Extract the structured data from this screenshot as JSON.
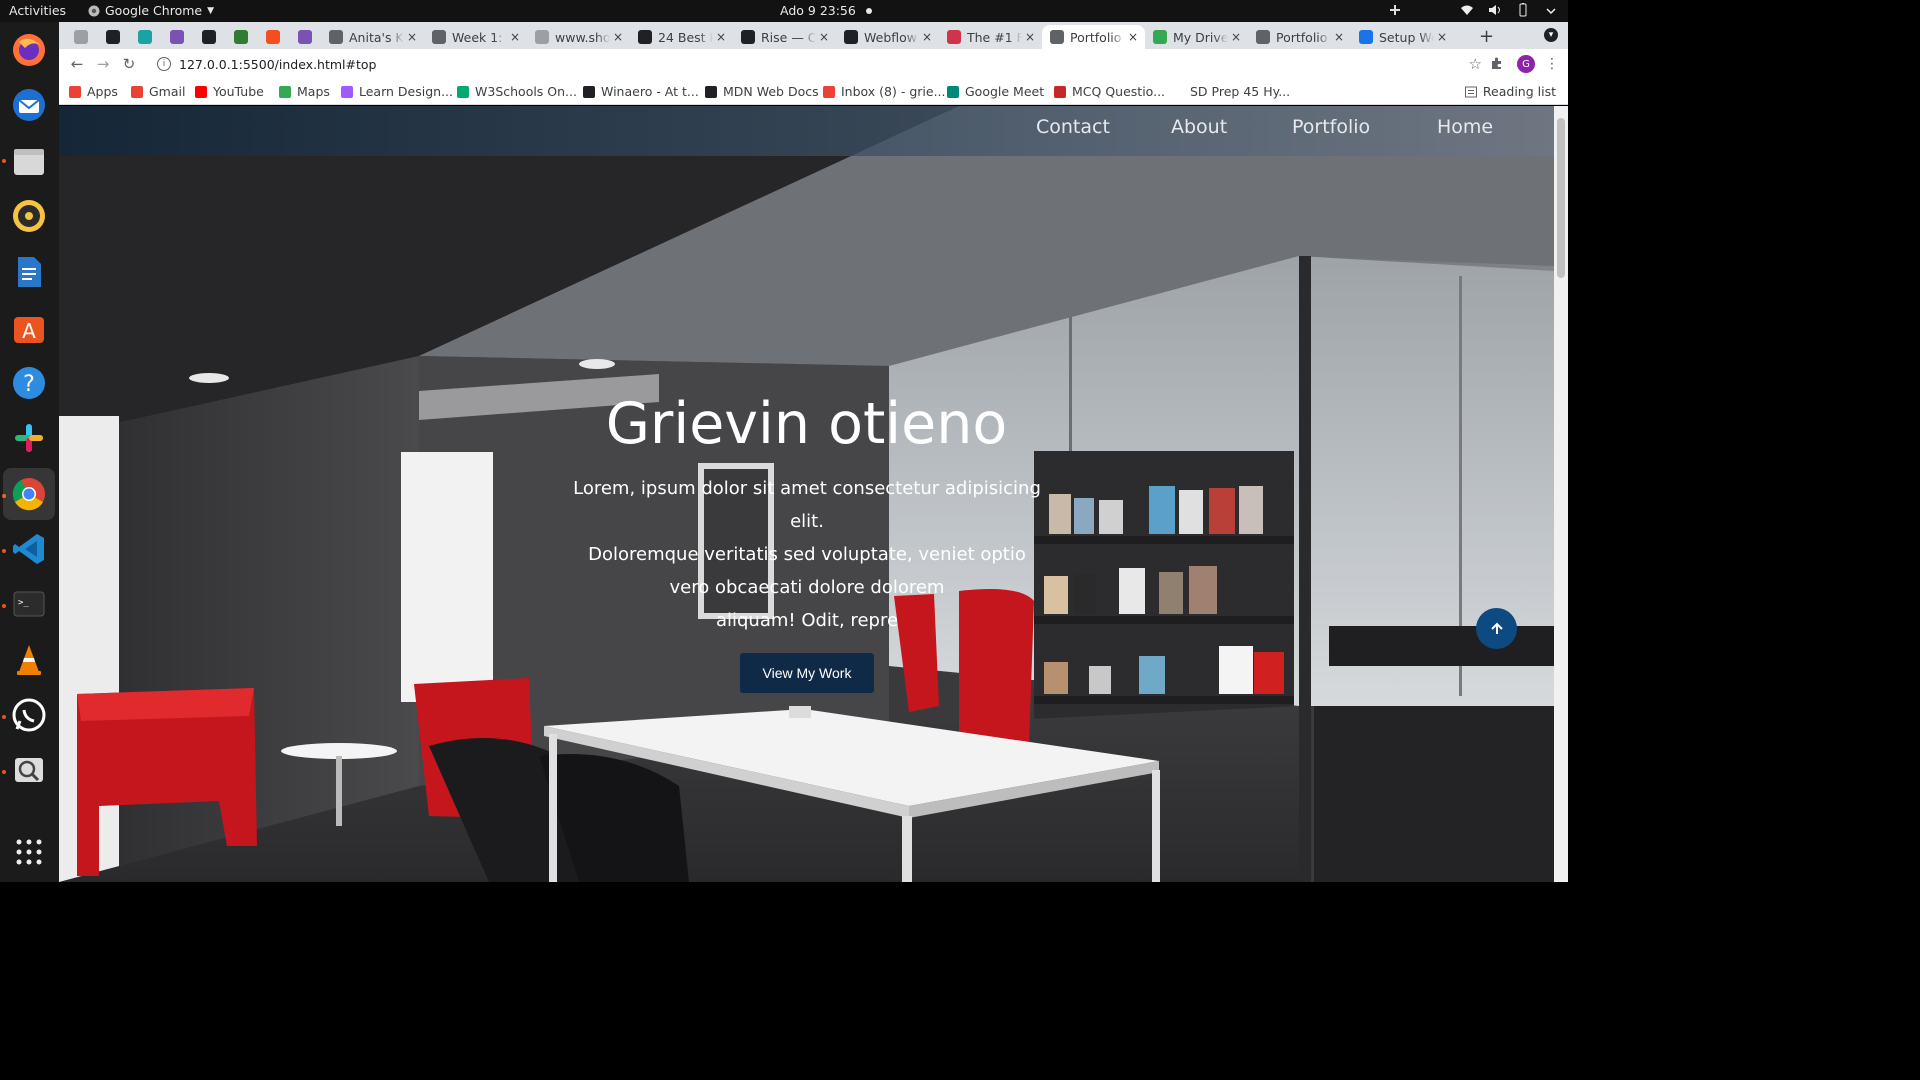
{
  "system": {
    "activities": "Activities",
    "app_name": "Google Chrome",
    "clock": "Ado 9  23:56"
  },
  "tabs": [
    {
      "title": "",
      "favicon": "ubuntu-icon",
      "color": "#9aa0a6"
    },
    {
      "title": "",
      "favicon": "x-logo-icon",
      "color": "#202124"
    },
    {
      "title": "",
      "favicon": "d-logo-icon",
      "color": "#1aa3a3"
    },
    {
      "title": "",
      "favicon": "b-logo-icon",
      "color": "#7952b3"
    },
    {
      "title": "",
      "favicon": "github-icon",
      "color": "#202124"
    },
    {
      "title": "",
      "favicon": "w-logo-icon",
      "color": "#2e7d32"
    },
    {
      "title": "",
      "favicon": "figma-icon",
      "color": "#f24e1e"
    },
    {
      "title": "",
      "favicon": "b-logo-icon",
      "color": "#7952b3"
    },
    {
      "title": "Anita's K",
      "favicon": "globe-icon",
      "color": "#5f6368"
    },
    {
      "title": "Week 1: I",
      "favicon": "pin-icon",
      "color": "#5f6368"
    },
    {
      "title": "www.sho",
      "favicon": "globe-icon",
      "color": "#9aa0a6"
    },
    {
      "title": "24 Best P",
      "favicon": "w-logo-icon",
      "color": "#202124"
    },
    {
      "title": "Rise — Cr",
      "favicon": "rise-icon",
      "color": "#202124"
    },
    {
      "title": "Webflow",
      "favicon": "webflow-icon",
      "color": "#202124"
    },
    {
      "title": "The #1 Fr",
      "favicon": "elementor-icon",
      "color": "#d1334a"
    },
    {
      "title": "Portfolio",
      "favicon": "globe-icon",
      "color": "#5f6368",
      "active": true
    },
    {
      "title": "My Drive",
      "favicon": "drive-icon",
      "color": "#34a853"
    },
    {
      "title": "Portfolio",
      "favicon": "globe-icon",
      "color": "#5f6368"
    },
    {
      "title": "Setup We",
      "favicon": "flag-icon",
      "color": "#1a73e8"
    }
  ],
  "toolbar": {
    "url": "127.0.0.1:5500/index.html#top"
  },
  "bookmarks": [
    {
      "label": "Apps",
      "color": "#ea4335"
    },
    {
      "label": "Gmail",
      "color": "#ea4335"
    },
    {
      "label": "YouTube",
      "color": "#ff0000"
    },
    {
      "label": "Maps",
      "color": "#34a853"
    },
    {
      "label": "Learn Design...",
      "color": "#a259ff"
    },
    {
      "label": "W3Schools On...",
      "color": "#04aa6d"
    },
    {
      "label": "Winaero - At t...",
      "color": "#202124"
    },
    {
      "label": "MDN Web Docs",
      "color": "#202124"
    },
    {
      "label": "Inbox (8) - grie...",
      "color": "#ea4335"
    },
    {
      "label": "Google Meet",
      "color": "#00897b"
    },
    {
      "label": "MCQ Questio...",
      "color": "#c62828"
    },
    {
      "label": "SD Prep 45 Hy...",
      "color": "#ffffff"
    }
  ],
  "reading_list": "Reading list",
  "site": {
    "nav": [
      "Contact",
      "About",
      "Portfolio",
      "Home"
    ],
    "hero_title": "Grievin otieno",
    "hero_lines": [
      "Lorem, ipsum dolor sit amet consectetur adipisicing elit.",
      "Doloremque veritatis sed voluptate, veniet optio",
      "vero obcaecati dolore dolorem",
      "aliquam! Odit, repre"
    ],
    "cta": "View My Work"
  },
  "colors": {
    "nav_bg": "#142638",
    "cta_bg": "#0e2a47",
    "scroll_top_bg": "#0d4a82",
    "accent_red": "#c4161c"
  }
}
